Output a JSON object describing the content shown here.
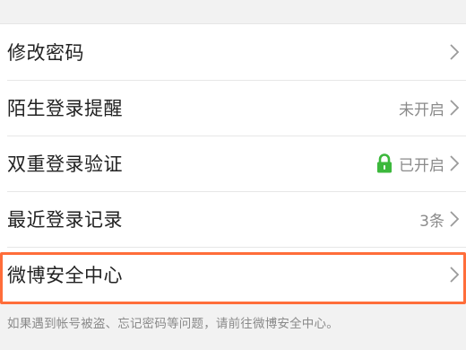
{
  "settings": {
    "rows": [
      {
        "label": "修改密码",
        "status": ""
      },
      {
        "label": "陌生登录提醒",
        "status": "未开启"
      },
      {
        "label": "双重登录验证",
        "status": "已开启"
      },
      {
        "label": "最近登录记录",
        "status": "3条"
      },
      {
        "label": "微博安全中心",
        "status": ""
      }
    ],
    "hint": "如果遇到帐号被盗、忘记密码等问题，请前往微博安全中心。"
  },
  "icons": {
    "chevron": "chevron-right-icon",
    "lock": "lock-icon"
  },
  "colors": {
    "lock_green": "#3cb83c",
    "highlight": "#ff6d3a",
    "status_gray": "#8a8a8a"
  }
}
